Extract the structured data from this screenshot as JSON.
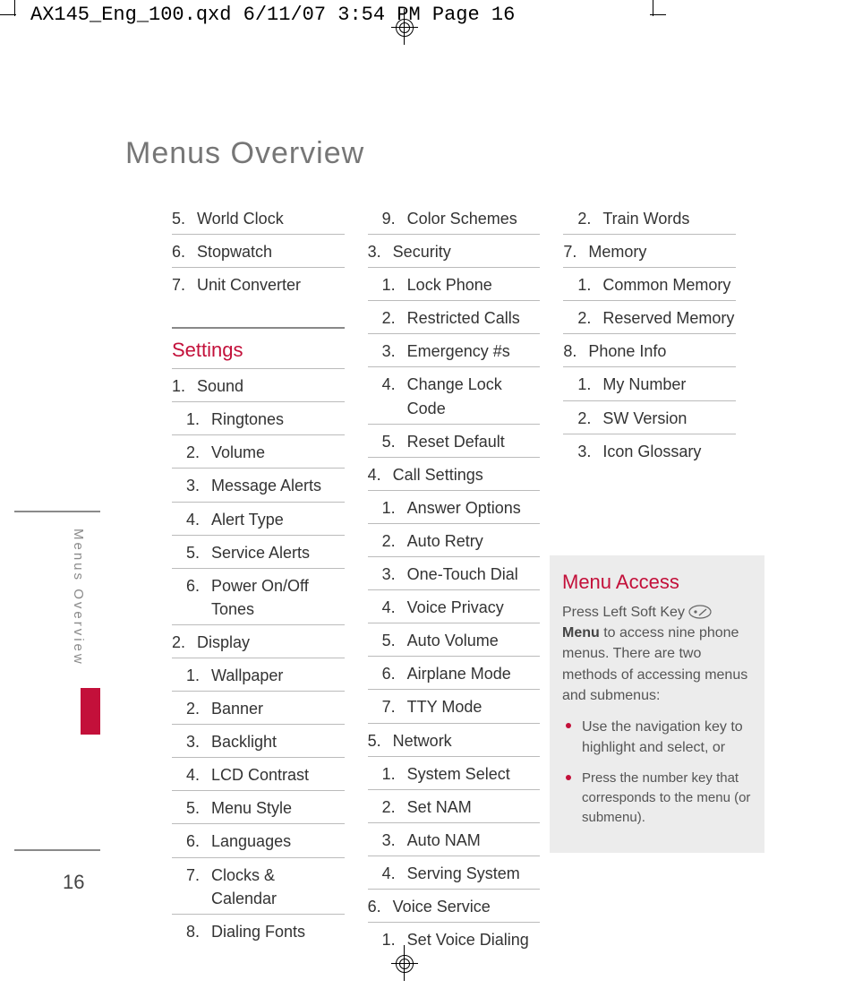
{
  "slug": "AX145_Eng_100.qxd  6/11/07  3:54 PM  Page 16",
  "title": "Menus Overview",
  "side_tab": "Menus Overview",
  "page_number": "16",
  "col1": {
    "pre": [
      {
        "n": "5.",
        "t": "World Clock"
      },
      {
        "n": "6.",
        "t": "Stopwatch"
      },
      {
        "n": "7.",
        "t": "Unit Converter",
        "noline": true
      }
    ],
    "settings_heading": "Settings",
    "s1": {
      "n": "1.",
      "t": "Sound",
      "items": [
        {
          "n": "1.",
          "t": "Ringtones"
        },
        {
          "n": "2.",
          "t": "Volume"
        },
        {
          "n": "3.",
          "t": "Message Alerts"
        },
        {
          "n": "4.",
          "t": "Alert Type"
        },
        {
          "n": "5.",
          "t": "Service Alerts"
        },
        {
          "n": "6.",
          "t": "Power On/Off Tones"
        }
      ]
    },
    "s2": {
      "n": "2.",
      "t": "Display",
      "items": [
        {
          "n": "1.",
          "t": "Wallpaper"
        },
        {
          "n": "2.",
          "t": "Banner"
        },
        {
          "n": "3.",
          "t": "Backlight"
        },
        {
          "n": "4.",
          "t": "LCD Contrast"
        },
        {
          "n": "5.",
          "t": "Menu Style"
        },
        {
          "n": "6.",
          "t": "Languages"
        },
        {
          "n": "7.",
          "t": "Clocks & Calendar"
        },
        {
          "n": "8.",
          "t": "Dialing Fonts",
          "noline": true
        }
      ]
    }
  },
  "col2": {
    "lead_sub": {
      "n": "9.",
      "t": "Color Schemes"
    },
    "groups": [
      {
        "n": "3.",
        "t": "Security",
        "items": [
          {
            "n": "1.",
            "t": "Lock Phone"
          },
          {
            "n": "2.",
            "t": "Restricted Calls"
          },
          {
            "n": "3.",
            "t": "Emergency #s"
          },
          {
            "n": "4.",
            "t": "Change Lock Code"
          },
          {
            "n": "5.",
            "t": "Reset Default"
          }
        ]
      },
      {
        "n": "4.",
        "t": "Call Settings",
        "items": [
          {
            "n": "1.",
            "t": "Answer Options"
          },
          {
            "n": "2.",
            "t": "Auto Retry"
          },
          {
            "n": "3.",
            "t": "One-Touch Dial"
          },
          {
            "n": "4.",
            "t": "Voice Privacy"
          },
          {
            "n": "5.",
            "t": "Auto Volume"
          },
          {
            "n": "6.",
            "t": "Airplane Mode"
          },
          {
            "n": "7.",
            "t": "TTY Mode"
          }
        ]
      },
      {
        "n": "5.",
        "t": "Network",
        "items": [
          {
            "n": "1.",
            "t": "System Select"
          },
          {
            "n": "2.",
            "t": "Set NAM"
          },
          {
            "n": "3.",
            "t": "Auto NAM"
          },
          {
            "n": "4.",
            "t": "Serving System"
          }
        ]
      },
      {
        "n": "6.",
        "t": "Voice Service",
        "items": [
          {
            "n": "1.",
            "t": "Set Voice Dialing",
            "noline": true
          }
        ]
      }
    ]
  },
  "col3": {
    "lead_sub": {
      "n": "2.",
      "t": "Train Words"
    },
    "groups": [
      {
        "n": "7.",
        "t": "Memory",
        "items": [
          {
            "n": "1.",
            "t": "Common Memory"
          },
          {
            "n": "2.",
            "t": "Reserved Memory"
          }
        ]
      },
      {
        "n": "8.",
        "t": "Phone Info",
        "items": [
          {
            "n": "1.",
            "t": "My Number"
          },
          {
            "n": "2.",
            "t": "SW Version"
          },
          {
            "n": "3.",
            "t": "Icon Glossary",
            "noline": true
          }
        ]
      }
    ]
  },
  "box": {
    "heading": "Menu Access",
    "p1a": "Press Left Soft Key ",
    "p1b_bold": "Menu",
    "p1c": " to access nine phone menus. There are two methods of accessing menus and submenus:",
    "b1": "Use the navigation key to highlight and select, or",
    "b2": "Press the number key that corresponds to the menu (or submenu)."
  }
}
